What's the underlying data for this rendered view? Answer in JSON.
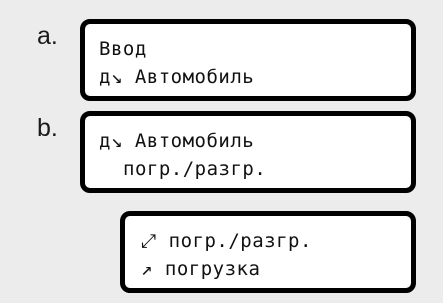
{
  "steps": {
    "a": {
      "label": "a.",
      "line1": "Ввод",
      "line2": "д↘ Автомобиль"
    },
    "b": {
      "label": "b.",
      "line1": "д↘ Автомобиль",
      "line2": "погр./разгр."
    },
    "c": {
      "line1": "⤢ погр./разгр.",
      "line2": "↗ погрузка"
    }
  }
}
